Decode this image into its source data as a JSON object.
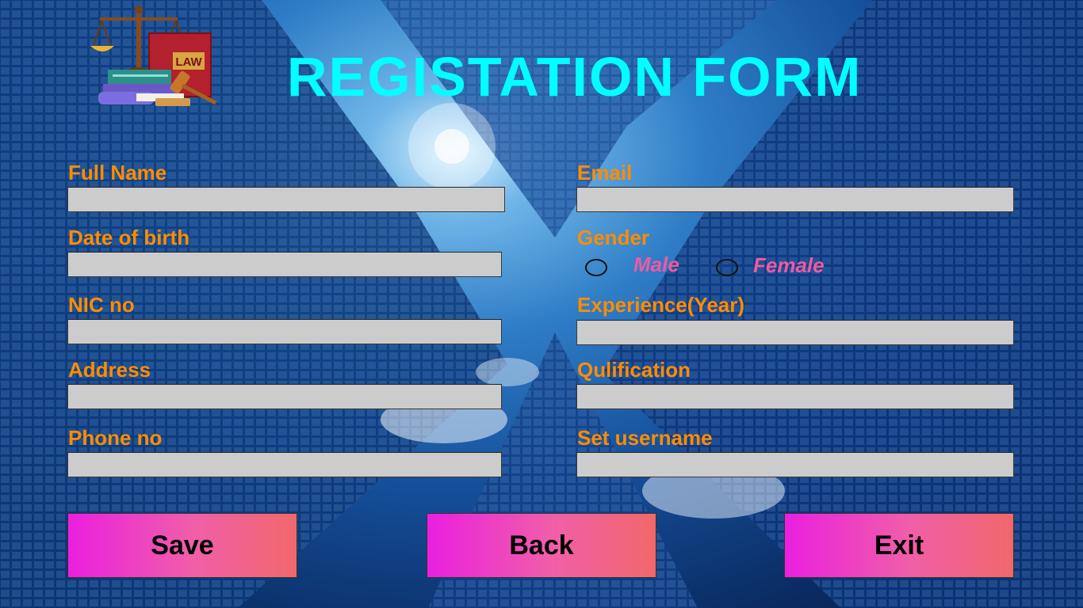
{
  "title": "REGISTATION FORM",
  "logo": {
    "icon": "law-scales-books-gavel-icon",
    "book_text": "LAW"
  },
  "fields": {
    "full_name": {
      "label": "Full Name",
      "value": "",
      "placeholder": ""
    },
    "email": {
      "label": "Email",
      "value": "",
      "placeholder": ""
    },
    "dob": {
      "label": "Date of birth",
      "value": "",
      "placeholder": ""
    },
    "nic": {
      "label": "NIC no",
      "value": "",
      "placeholder": ""
    },
    "experience": {
      "label": "Experience(Year)",
      "value": "",
      "placeholder": ""
    },
    "address": {
      "label": "Address",
      "value": "",
      "placeholder": ""
    },
    "qualification": {
      "label": "Qulification",
      "value": "",
      "placeholder": ""
    },
    "phone": {
      "label": "Phone no",
      "value": "",
      "placeholder": ""
    },
    "username": {
      "label": "Set username",
      "value": "",
      "placeholder": ""
    }
  },
  "gender": {
    "label": "Gender",
    "options": [
      "Male",
      "Female"
    ],
    "selected": null
  },
  "buttons": {
    "save": "Save",
    "back": "Back",
    "exit": "Exit"
  },
  "colors": {
    "title": "#00ffff",
    "label": "#ff8c00",
    "radio_label": "#ef5aa0",
    "input_bg": "#cccccc",
    "button_gradient_start": "#ea1fe0",
    "button_gradient_end": "#f1686b"
  }
}
